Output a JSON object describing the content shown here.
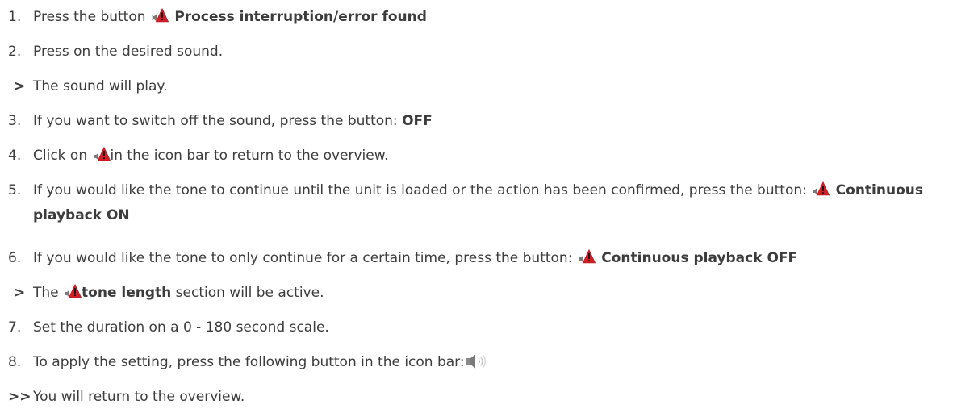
{
  "steps": [
    {
      "marker": "1.",
      "text": "Press the button ",
      "bold": "Process interruption/error found"
    },
    {
      "marker": "2.",
      "text": "Press on the desired sound."
    },
    {
      "marker": ">",
      "text": "The sound will play."
    },
    {
      "marker": "3.",
      "text": "If you want to switch off the sound, press the button: ",
      "bold": "OFF"
    },
    {
      "marker": "4.",
      "pre": "Click on ",
      "post": "in the icon bar to return to the overview."
    },
    {
      "marker": "5.",
      "text": "If you would like the tone to continue until the unit is loaded or the action has been confirmed, press the button: ",
      "bold": "Continuous playback ON"
    },
    {
      "marker": "6.",
      "text": "If you would like the tone to only continue for a certain time, press the button: ",
      "bold": "Continuous playback OFF"
    },
    {
      "marker": ">",
      "pre": "The ",
      "bold": "tone length",
      "post": " section will be active."
    },
    {
      "marker": "7.",
      "text": "Set the duration on a 0 - 180 second scale."
    },
    {
      "marker": "8.",
      "text": "To apply the setting, press the following button in the icon bar:"
    },
    {
      "marker": ">>",
      "text": "You will return to the overview."
    }
  ],
  "icons": {
    "alarm": "alarm-sound-warning-icon",
    "apply": "speaker-volume-icon"
  },
  "colors": {
    "text": "#3c3c3c",
    "warning_red": "#d11f26",
    "icon_grey": "#8a8a8a"
  }
}
